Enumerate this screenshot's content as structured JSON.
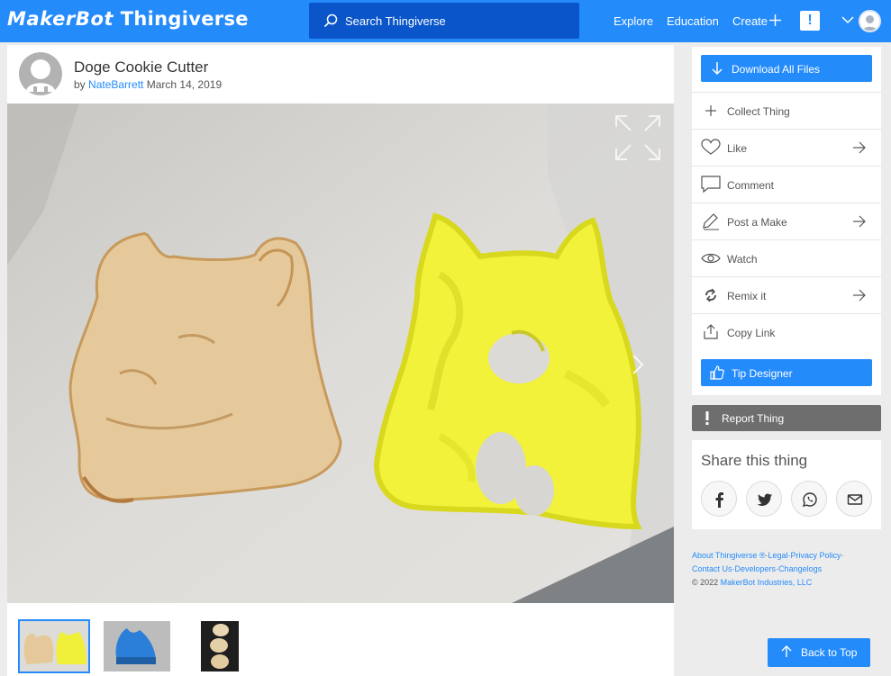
{
  "header": {
    "brand_maker": "MakerBot",
    "brand_thing": "Thingiverse",
    "search_label": "Search Thingiverse",
    "nav": {
      "explore": "Explore",
      "education": "Education",
      "create": "Create"
    },
    "alert_badge": "!"
  },
  "thing": {
    "title": "Doge Cookie Cutter",
    "by": "by",
    "author": "NateBarrett",
    "date": "March 14, 2019"
  },
  "gallery": {
    "thumbnails": [
      "cookie-and-cutter",
      "blue-cutter",
      "cookies-stack"
    ],
    "active_index": 0
  },
  "actions": {
    "download": "Download All Files",
    "collect": "Collect Thing",
    "like": "Like",
    "comment": "Comment",
    "post_make": "Post a Make",
    "watch": "Watch",
    "remix": "Remix it",
    "copy_link": "Copy Link",
    "tip": "Tip Designer"
  },
  "report": "Report Thing",
  "share": {
    "title": "Share this thing",
    "icons": [
      "facebook-icon",
      "twitter-icon",
      "whatsapp-icon",
      "email-icon"
    ]
  },
  "footer": {
    "about": "About Thingiverse ®",
    "legal": "Legal",
    "privacy": "Privacy Policy",
    "contact": "Contact Us",
    "developers": "Developers",
    "changelogs": "Changelogs",
    "copyright": "© 2022",
    "company": "MakerBot Industries, LLC"
  },
  "back_to_top": "Back to Top",
  "colors": {
    "brand": "#248bfb",
    "search_bg": "#0955c9",
    "report_bg": "#6e6e6e",
    "page_bg": "#ececec"
  }
}
